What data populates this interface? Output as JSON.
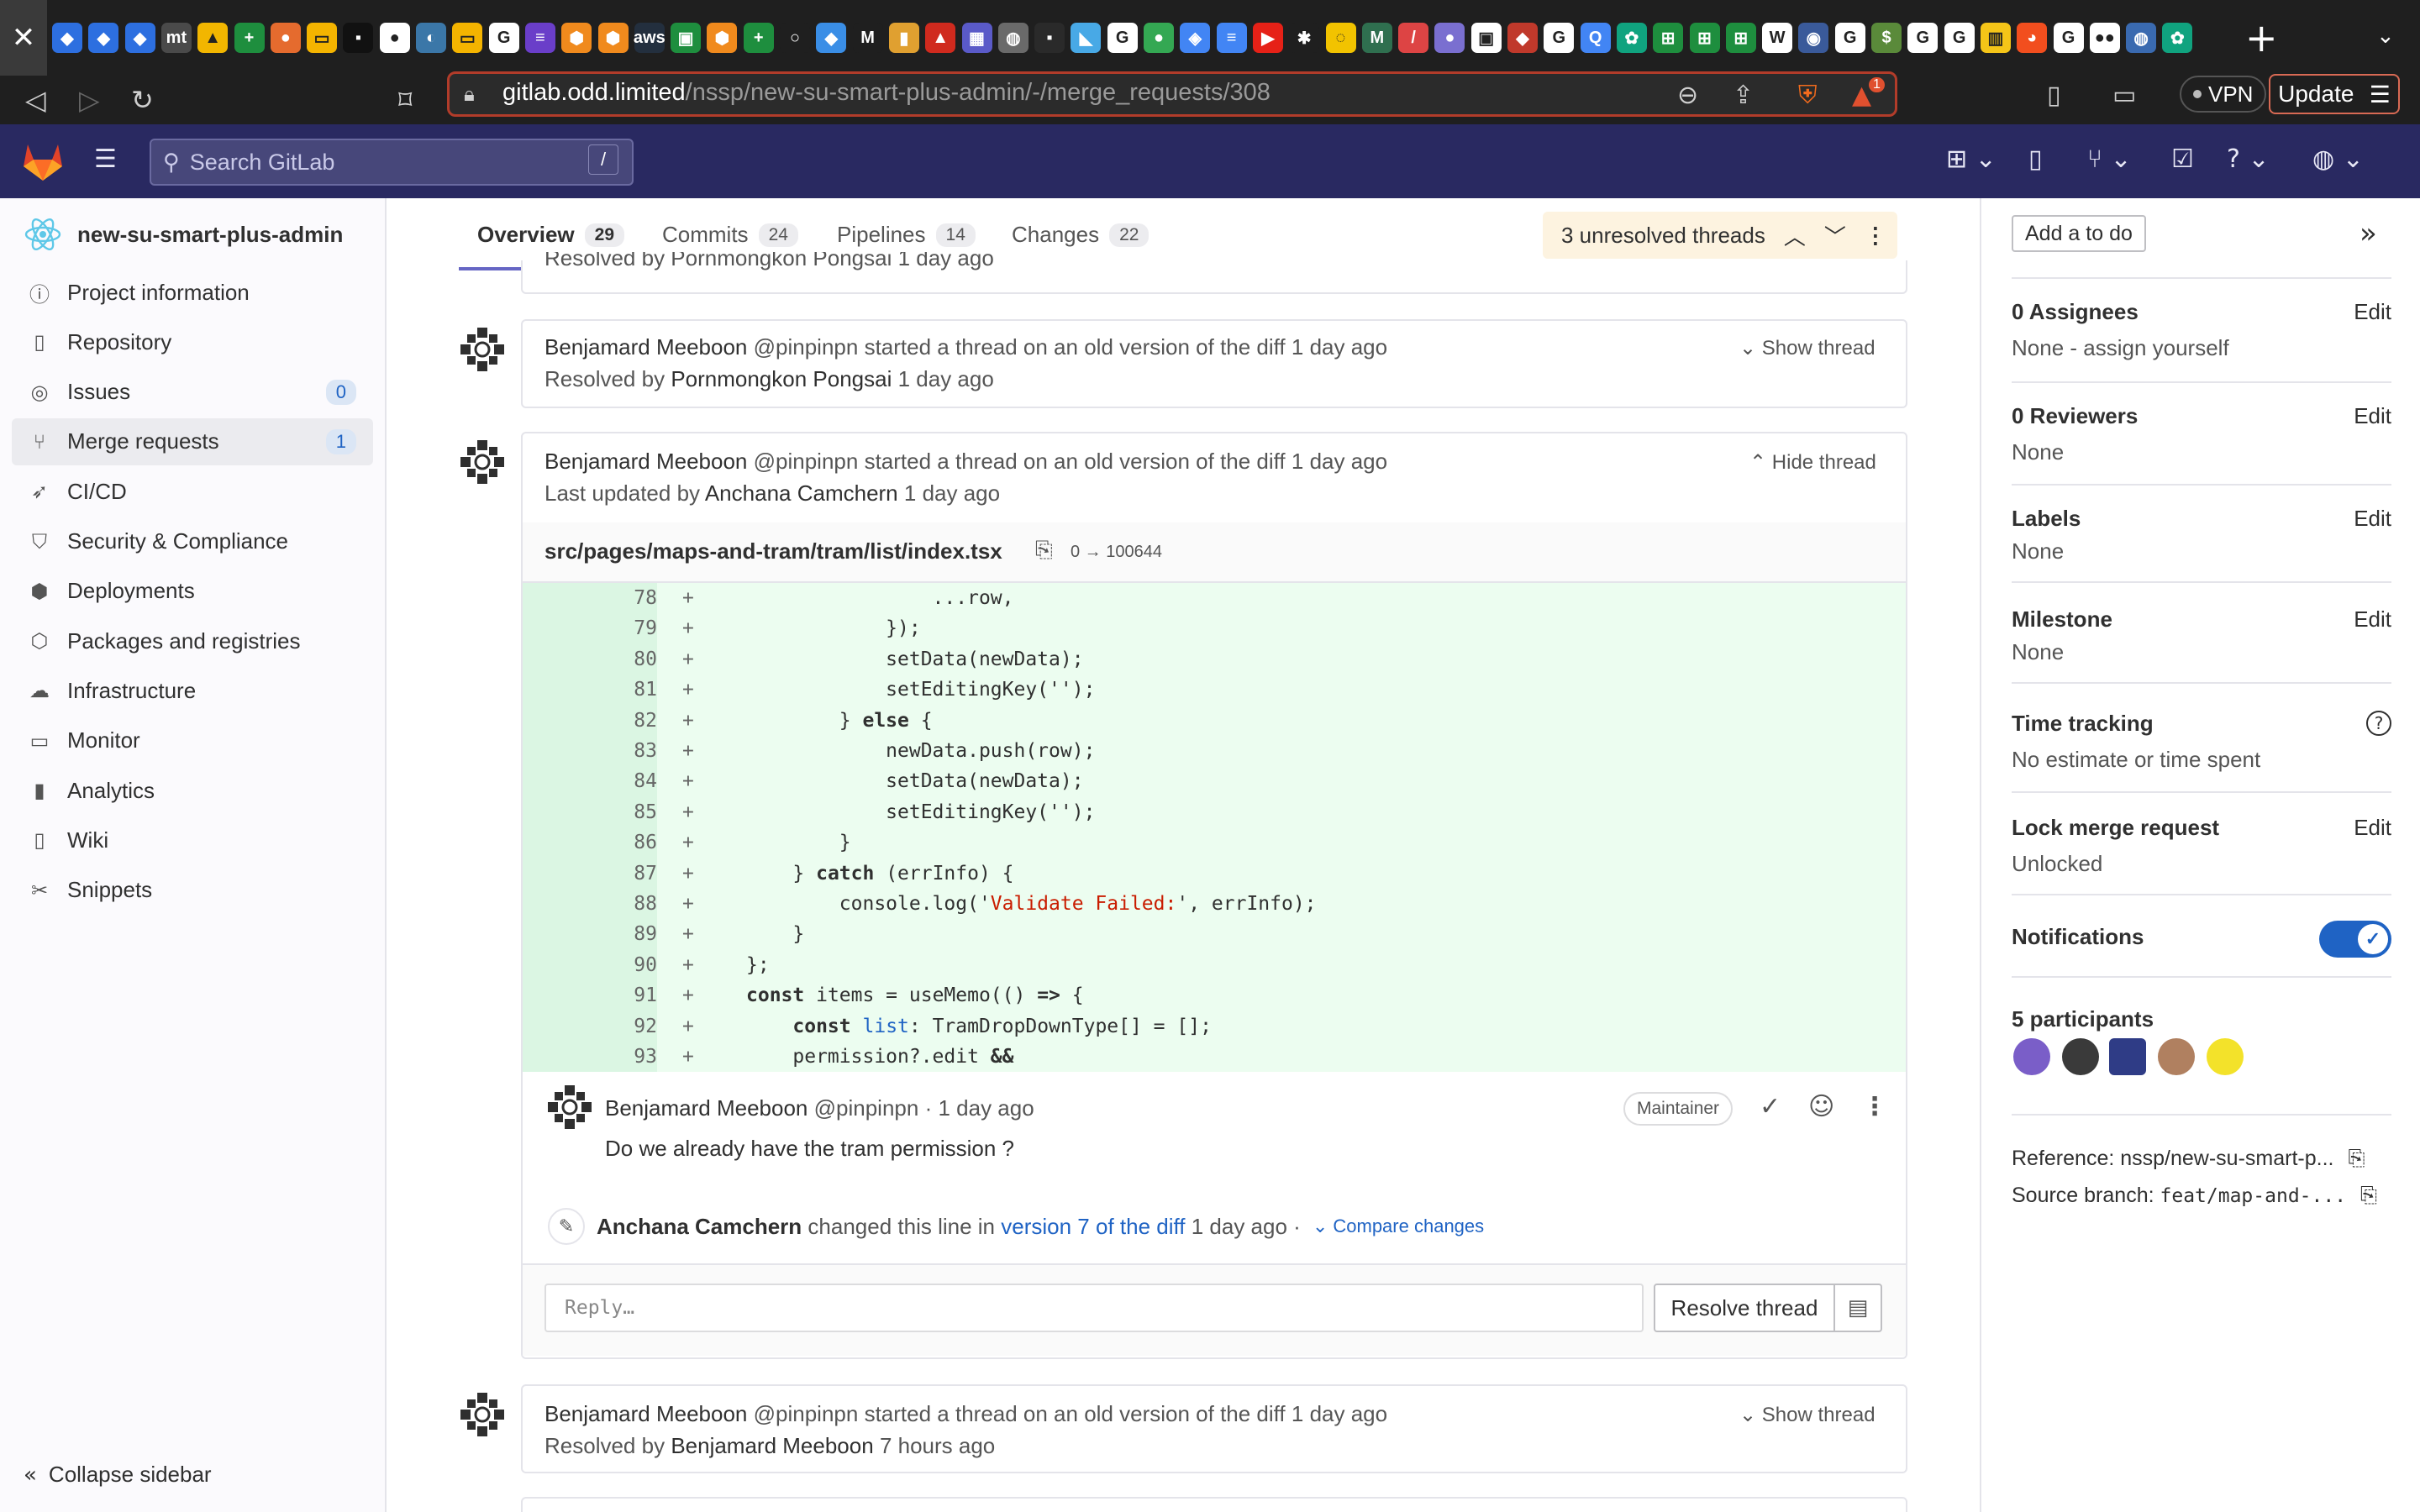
{
  "browser": {
    "tab_close_glyph": "✕",
    "url_host": "gitlab.odd.limited",
    "url_path": "/nssp/new-su-smart-plus-admin/-/merge_requests/308",
    "vpn_label": "VPN",
    "update_label": "Update",
    "shield_badge": "1",
    "favicons": [
      {
        "icon": "jira-icon",
        "color": "#2d6fe0",
        "glyph": "◆"
      },
      {
        "icon": "jira-icon",
        "color": "#2d6fe0",
        "glyph": "◆"
      },
      {
        "icon": "jira-icon",
        "color": "#2d6fe0",
        "glyph": "◆"
      },
      {
        "icon": "mt-icon",
        "color": "#4a4a4a",
        "glyph": "mt"
      },
      {
        "icon": "drive-icon",
        "color": "#f2b600",
        "glyph": "▲"
      },
      {
        "icon": "sheets-icon",
        "color": "#1e8e3e",
        "glyph": "+"
      },
      {
        "icon": "mango-icon",
        "color": "#e56b2e",
        "glyph": "●"
      },
      {
        "icon": "slides-icon",
        "color": "#f4b400",
        "glyph": "▭"
      },
      {
        "icon": "terminal-icon",
        "color": "#111111",
        "glyph": "▪"
      },
      {
        "icon": "github-icon",
        "color": "#ffffff",
        "glyph": "●"
      },
      {
        "icon": "python-icon",
        "color": "#3b77a8",
        "glyph": "◐"
      },
      {
        "icon": "slides-icon",
        "color": "#f4b400",
        "glyph": "▭"
      },
      {
        "icon": "google-icon",
        "color": "#ffffff",
        "glyph": "G"
      },
      {
        "icon": "forms-icon",
        "color": "#6a3ec9",
        "glyph": "≡"
      },
      {
        "icon": "aws-icon",
        "color": "#f08a1d",
        "glyph": "⬢"
      },
      {
        "icon": "aws-icon",
        "color": "#f08a1d",
        "glyph": "⬢"
      },
      {
        "icon": "aws-text-icon",
        "color": "#232f3e",
        "glyph": "aws"
      },
      {
        "icon": "sheets-icon",
        "color": "#1e8e3e",
        "glyph": "▣"
      },
      {
        "icon": "aws-icon",
        "color": "#f08a1d",
        "glyph": "⬢"
      },
      {
        "icon": "sheets-icon",
        "color": "#1e8e3e",
        "glyph": "+"
      },
      {
        "icon": "circle-icon",
        "color": "#1f1f1f",
        "glyph": "○"
      },
      {
        "icon": "vscode-icon",
        "color": "#3a8ee6",
        "glyph": "◆"
      },
      {
        "icon": "medium-icon",
        "color": "#1f1f1f",
        "glyph": "M"
      },
      {
        "icon": "bottle-icon",
        "color": "#e0a030",
        "glyph": "▮"
      },
      {
        "icon": "alert-icon",
        "color": "#d02a1e",
        "glyph": "▲"
      },
      {
        "icon": "calendar-icon",
        "color": "#5a5ac8",
        "glyph": "▦"
      },
      {
        "icon": "globe-icon",
        "color": "#6a6a6a",
        "glyph": "◍"
      },
      {
        "icon": "square-icon",
        "color": "#2a2a2a",
        "glyph": "▪"
      },
      {
        "icon": "flutter-icon",
        "color": "#48a9e6",
        "glyph": "◣"
      },
      {
        "icon": "google-icon",
        "color": "#ffffff",
        "glyph": "G"
      },
      {
        "icon": "maps-pin-icon",
        "color": "#34a853",
        "glyph": "●"
      },
      {
        "icon": "maps-icon",
        "color": "#4285f4",
        "glyph": "◈"
      },
      {
        "icon": "docs-icon",
        "color": "#4285f4",
        "glyph": "≡"
      },
      {
        "icon": "youtube-icon",
        "color": "#e62117",
        "glyph": "▶"
      },
      {
        "icon": "dark-icon",
        "color": "#1f1f1f",
        "glyph": "✱"
      },
      {
        "icon": "loader-icon",
        "color": "#f2c300",
        "glyph": "◌"
      },
      {
        "icon": "m-logo-icon",
        "color": "#2f6f4f",
        "glyph": "M"
      },
      {
        "icon": "slash-icon",
        "color": "#d44",
        "glyph": "/"
      },
      {
        "icon": "avatar-icon",
        "color": "#7a6fd0",
        "glyph": "●"
      },
      {
        "icon": "square-logo-icon",
        "color": "#ffffff",
        "glyph": "▣"
      },
      {
        "icon": "brave-like-icon",
        "color": "#c0392b",
        "glyph": "◆"
      },
      {
        "icon": "google-icon",
        "color": "#ffffff",
        "glyph": "G"
      },
      {
        "icon": "search-q-icon",
        "color": "#4285f4",
        "glyph": "Q"
      },
      {
        "icon": "openai-icon",
        "color": "#10a37f",
        "glyph": "✿"
      },
      {
        "icon": "sheets-icon",
        "color": "#1e8e3e",
        "glyph": "⊞"
      },
      {
        "icon": "sheets-icon",
        "color": "#1e8e3e",
        "glyph": "⊞"
      },
      {
        "icon": "sheets-icon",
        "color": "#1e8e3e",
        "glyph": "⊞"
      },
      {
        "icon": "wikipedia-icon",
        "color": "#ffffff",
        "glyph": "W"
      },
      {
        "icon": "eye-icon",
        "color": "#3a5a9a",
        "glyph": "◉"
      },
      {
        "icon": "google-icon",
        "color": "#ffffff",
        "glyph": "G"
      },
      {
        "icon": "dollar-icon",
        "color": "#5a8a3a",
        "glyph": "$"
      },
      {
        "icon": "google-icon",
        "color": "#ffffff",
        "glyph": "G"
      },
      {
        "icon": "google-icon",
        "color": "#ffffff",
        "glyph": "G"
      },
      {
        "icon": "imdb-icon",
        "color": "#f5c518",
        "glyph": "▥"
      },
      {
        "icon": "figma-icon",
        "color": "#f24e1e",
        "glyph": "◕"
      },
      {
        "icon": "google-icon",
        "color": "#ffffff",
        "glyph": "G"
      },
      {
        "icon": "medium-icon",
        "color": "#ffffff",
        "glyph": "●●"
      },
      {
        "icon": "globe-icon",
        "color": "#3a6ab0",
        "glyph": "◍"
      },
      {
        "icon": "openai-icon",
        "color": "#10a37f",
        "glyph": "✿"
      }
    ]
  },
  "gitlab": {
    "search_placeholder": "Search GitLab",
    "search_shortcut": "/"
  },
  "sidebar": {
    "project_name": "new-su-smart-plus-admin",
    "items": [
      {
        "label": "Project information",
        "icon": "info-icon",
        "glyph": "ⓘ"
      },
      {
        "label": "Repository",
        "icon": "book-icon",
        "glyph": "▯"
      },
      {
        "label": "Issues",
        "icon": "issues-icon",
        "glyph": "◎",
        "count": "0"
      },
      {
        "label": "Merge requests",
        "icon": "merge-request-icon",
        "glyph": "⑂",
        "count": "1",
        "active": true
      },
      {
        "label": "CI/CD",
        "icon": "rocket-icon",
        "glyph": "➶"
      },
      {
        "label": "Security & Compliance",
        "icon": "shield-icon",
        "glyph": "⛉"
      },
      {
        "label": "Deployments",
        "icon": "deployments-icon",
        "glyph": "⬢"
      },
      {
        "label": "Packages and registries",
        "icon": "package-icon",
        "glyph": "⬡"
      },
      {
        "label": "Infrastructure",
        "icon": "cloud-icon",
        "glyph": "☁"
      },
      {
        "label": "Monitor",
        "icon": "monitor-icon",
        "glyph": "▭"
      },
      {
        "label": "Analytics",
        "icon": "chart-icon",
        "glyph": "▮"
      },
      {
        "label": "Wiki",
        "icon": "wiki-icon",
        "glyph": "▯"
      },
      {
        "label": "Snippets",
        "icon": "scissors-icon",
        "glyph": "✂"
      }
    ],
    "collapse_label": "Collapse sidebar"
  },
  "mr_tabs": [
    {
      "label": "Overview",
      "count": "29"
    },
    {
      "label": "Commits",
      "count": "24"
    },
    {
      "label": "Pipelines",
      "count": "14"
    },
    {
      "label": "Changes",
      "count": "22"
    }
  ],
  "threads": {
    "unresolved_label": "3 unresolved threads",
    "top_cut_text": "Resolved by Pornmongkon Pongsai 1 day ago",
    "thread1": {
      "author": "Benjamard Meeboon",
      "handle": "@pinpinpn",
      "action": "started a thread on an old version of the diff",
      "time": "1 day ago",
      "status_prefix": "Resolved by",
      "status_user": "Pornmongkon Pongsai",
      "status_time": "1 day ago",
      "toggle": "Show thread"
    },
    "thread2": {
      "author": "Benjamard Meeboon",
      "handle": "@pinpinpn",
      "action": "started a thread on an old version of the diff",
      "time": "1 day ago",
      "status_prefix": "Last updated by",
      "status_user": "Anchana Camchern",
      "status_time": "1 day ago",
      "toggle": "Hide thread",
      "file": "src/pages/maps-and-tram/tram/list/index.tsx",
      "file_mode": "0 → 100644",
      "note": {
        "author": "Benjamard Meeboon",
        "handle": "@pinpinpn",
        "time": "· 1 day ago",
        "role": "Maintainer",
        "body": "Do we already have the tram permission ?"
      },
      "system_note": {
        "user": "Anchana Camchern",
        "text": "changed this line in",
        "link": "version 7 of the diff",
        "time": "1 day ago ·",
        "compare": "Compare changes"
      },
      "reply_placeholder": "Reply…",
      "resolve_label": "Resolve thread"
    },
    "thread3": {
      "author": "Benjamard Meeboon",
      "handle": "@pinpinpn",
      "action": "started a thread on an old version of the diff",
      "time": "1 day ago",
      "status_prefix": "Resolved by",
      "status_user": "Benjamard Meeboon",
      "status_time": "7 hours ago",
      "toggle": "Show thread"
    }
  },
  "diff_lines": [
    {
      "n": "78",
      "html": "                ...row,"
    },
    {
      "n": "79",
      "html": "            });"
    },
    {
      "n": "80",
      "html": "            setData(newData);"
    },
    {
      "n": "81",
      "html": "            setEditingKey('');"
    },
    {
      "n": "82",
      "html": "        } <span class=\"kw\">else</span> {"
    },
    {
      "n": "83",
      "html": "            newData.push(row);"
    },
    {
      "n": "84",
      "html": "            setData(newData);"
    },
    {
      "n": "85",
      "html": "            setEditingKey('');"
    },
    {
      "n": "86",
      "html": "        }"
    },
    {
      "n": "87",
      "html": "    } <span class=\"kw\">catch</span> (errInfo) {"
    },
    {
      "n": "88",
      "html": "        console.log('<span class=\"str\">Validate Failed:</span>', errInfo);"
    },
    {
      "n": "89",
      "html": "    }"
    },
    {
      "n": "90",
      "html": "};"
    },
    {
      "n": "91",
      "html": "<span class=\"kw\">const</span> items = useMemo(() <span class=\"kw\">=&gt;</span> {"
    },
    {
      "n": "92",
      "html": "    <span class=\"kw\">const</span> <span class=\"typ\">list</span>: TramDropDownType[] = [];"
    },
    {
      "n": "93",
      "html": "    permission?.edit <span class=\"kw\">&amp;&amp;</span>"
    }
  ],
  "right_sidebar": {
    "add_todo": "Add a to do",
    "edit_label": "Edit",
    "assignees_title": "0 Assignees",
    "assignees_value": "None - assign yourself",
    "reviewers_title": "0 Reviewers",
    "reviewers_value": "None",
    "labels_title": "Labels",
    "labels_value": "None",
    "milestone_title": "Milestone",
    "milestone_value": "None",
    "time_title": "Time tracking",
    "time_value": "No estimate or time spent",
    "lock_title": "Lock merge request",
    "lock_value": "Unlocked",
    "notifications_title": "Notifications",
    "notifications_on": true,
    "participants_title": "5 participants",
    "reference_label": "Reference: nssp/new-su-smart-p...",
    "branch_label": "Source branch:",
    "branch_value": "feat/map-and-..."
  },
  "colors": {
    "gitlab_nav": "#292961",
    "accent": "#1f63c4",
    "diff_added": "#ecfdf0",
    "unresolved_bg": "#fdf3e0"
  }
}
